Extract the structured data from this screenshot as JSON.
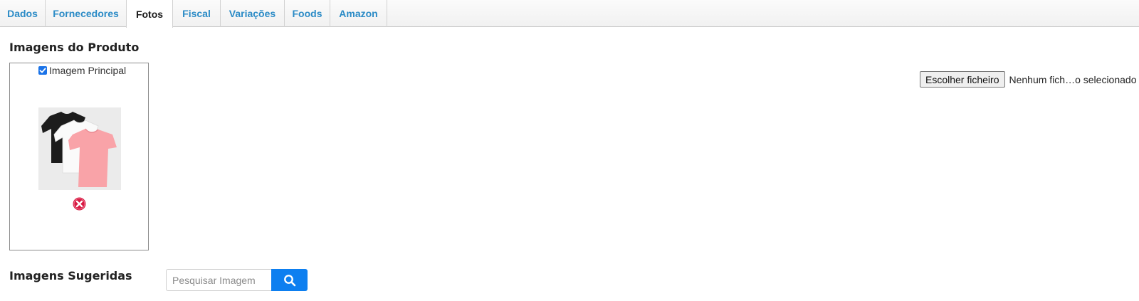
{
  "tabs": [
    {
      "label": "Dados",
      "active": false
    },
    {
      "label": "Fornecedores",
      "active": false
    },
    {
      "label": "Fotos",
      "active": true
    },
    {
      "label": "Fiscal",
      "active": false
    },
    {
      "label": "Variações",
      "active": false
    },
    {
      "label": "Foods",
      "active": false
    },
    {
      "label": "Amazon",
      "active": false
    }
  ],
  "product_images": {
    "title": "Imagens do Produto",
    "main_image_label": "Imagem Principal",
    "main_image_checked": true,
    "thumbnail_icon": "t-shirts-photo",
    "remove_icon": "remove-circle-icon"
  },
  "file_input": {
    "button_label": "Escolher ficheiro",
    "status_text": "Nenhum fich…o selecionado"
  },
  "suggested_images": {
    "title": "Imagens Sugeridas",
    "search_placeholder": "Pesquisar Imagem",
    "search_value": "",
    "search_icon": "search-icon"
  },
  "colors": {
    "tab_link": "#2b8bc6",
    "search_button": "#0d7ff0",
    "remove_icon": "#d81b43",
    "checkbox": "#1a73e8"
  }
}
